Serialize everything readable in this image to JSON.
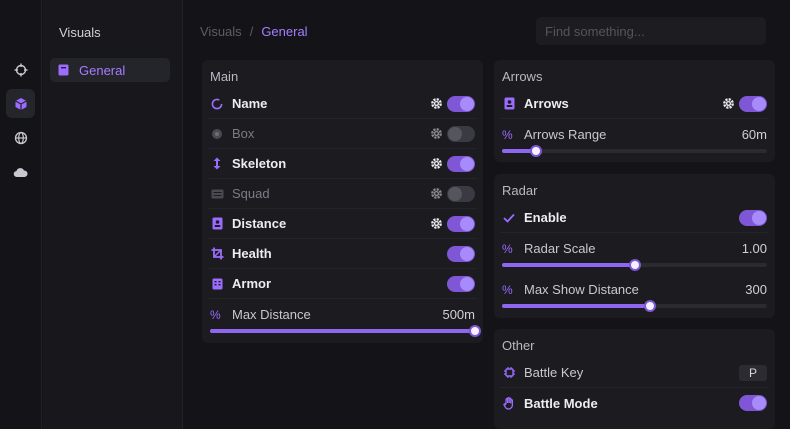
{
  "rail": {
    "items": [
      {
        "icon": "crosshair-icon",
        "active": false
      },
      {
        "icon": "cube-icon",
        "active": true
      },
      {
        "icon": "globe-icon",
        "active": false
      },
      {
        "icon": "cloud-icon",
        "active": false
      }
    ]
  },
  "sidebar": {
    "title": "Visuals",
    "items": [
      {
        "label": "General",
        "icon": "bookmark-icon",
        "active": true
      }
    ]
  },
  "header": {
    "breadcrumb": [
      "Visuals",
      "General"
    ],
    "breadcrumb_separator": "/",
    "search_placeholder": "Find something..."
  },
  "panels": {
    "main": {
      "title": "Main",
      "rows": [
        {
          "label": "Name",
          "icon": "ring-icon",
          "gear": true,
          "toggle": true
        },
        {
          "label": "Box",
          "icon": "target-icon",
          "gear": true,
          "toggle": false
        },
        {
          "label": "Skeleton",
          "icon": "vertical-arrows-icon",
          "gear": true,
          "toggle": true
        },
        {
          "label": "Squad",
          "icon": "keyboard-icon",
          "gear": true,
          "toggle": false
        },
        {
          "label": "Distance",
          "icon": "contact-card-icon",
          "gear": true,
          "toggle": true
        },
        {
          "label": "Health",
          "icon": "crop-icon",
          "gear": false,
          "toggle": true
        },
        {
          "label": "Armor",
          "icon": "grid-icon",
          "gear": false,
          "toggle": true
        }
      ],
      "slider": {
        "label": "Max Distance",
        "value": "500m",
        "fraction": 1.0
      }
    },
    "arrows": {
      "title": "Arrows",
      "row": {
        "label": "Arrows",
        "icon": "contact-card-icon",
        "gear": true,
        "toggle": true
      },
      "slider": {
        "label": "Arrows Range",
        "value": "60m",
        "fraction": 0.13
      }
    },
    "radar": {
      "title": "Radar",
      "row": {
        "label": "Enable",
        "icon": "check-icon",
        "toggle": true
      },
      "sliders": [
        {
          "label": "Radar Scale",
          "value": "1.00",
          "fraction": 0.5
        },
        {
          "label": "Max Show Distance",
          "value": "300",
          "fraction": 0.56
        }
      ]
    },
    "other": {
      "title": "Other",
      "rows": [
        {
          "label": "Battle Key",
          "icon": "chip-icon",
          "key": "P"
        },
        {
          "label": "Battle Mode",
          "icon": "hand-icon",
          "toggle": true
        }
      ]
    }
  },
  "colors": {
    "accent": "#9b6cff",
    "toggle_on": "#7f57d6",
    "background": "#141418",
    "panel": "#1b1b20"
  }
}
